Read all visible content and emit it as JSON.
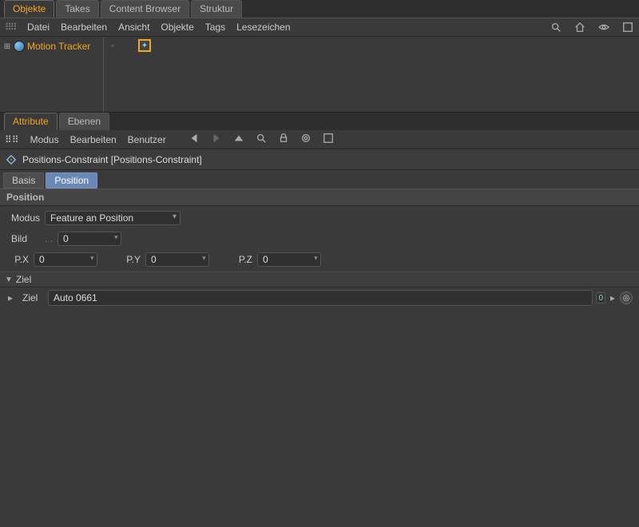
{
  "top_tabs": {
    "objekte": "Objekte",
    "takes": "Takes",
    "content": "Content Browser",
    "struktur": "Struktur"
  },
  "om_menu": {
    "datei": "Datei",
    "bearbeiten": "Bearbeiten",
    "ansicht": "Ansicht",
    "objekte": "Objekte",
    "tags": "Tags",
    "lesezeichen": "Lesezeichen"
  },
  "om_tree": {
    "item0": "Motion Tracker"
  },
  "attr_tabs": {
    "attribute": "Attribute",
    "ebenen": "Ebenen"
  },
  "attr_menu": {
    "modus": "Modus",
    "bearbeiten": "Bearbeiten",
    "benutzer": "Benutzer"
  },
  "attr_header": {
    "title": "Positions-Constraint [Positions-Constraint]"
  },
  "attr_inner_tabs": {
    "basis": "Basis",
    "position": "Position"
  },
  "section": {
    "position": "Position",
    "ziel": "Ziel"
  },
  "fields": {
    "modus_label": "Modus",
    "modus_value": "Feature an Position",
    "bild_label": "Bild",
    "bild_value": "0",
    "px_label": "P.X",
    "px_value": "0",
    "py_label": "P.Y",
    "py_value": "0",
    "pz_label": "P.Z",
    "pz_value": "0",
    "ziel_label": "Ziel",
    "ziel_value": "Auto 0661",
    "ziel_count": "0"
  }
}
